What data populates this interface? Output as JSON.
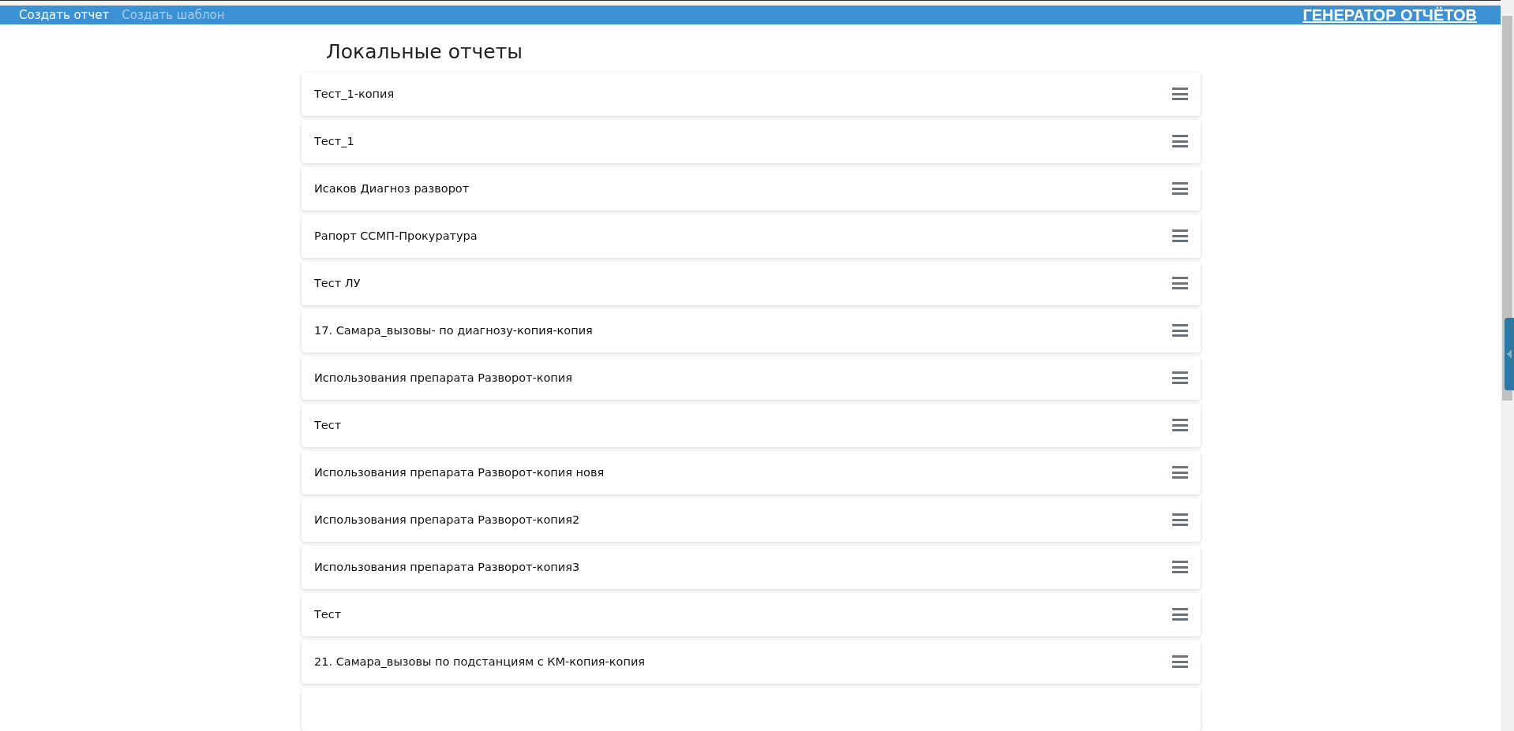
{
  "nav": [
    {
      "label": "Создать отчет",
      "selected": true
    },
    {
      "label": "Создать шаблон",
      "selected": false
    }
  ],
  "brand": "ГЕНЕРАТОР ОТЧЁТОВ",
  "page_title": "Локальные отчеты",
  "reports": [
    {
      "name": "Тест_1-копия"
    },
    {
      "name": "Тест_1"
    },
    {
      "name": "Исаков Диагноз разворот"
    },
    {
      "name": "Рапорт ССМП-Прокуратура"
    },
    {
      "name": "Тест ЛУ"
    },
    {
      "name": "17. Самара_вызовы- по диагнозу-копия-копия"
    },
    {
      "name": "Использования препарата Разворот-копия"
    },
    {
      "name": "Тест"
    },
    {
      "name": "Использования препарата Разворот-копия новя"
    },
    {
      "name": "Использования препарата Разворот-копия2"
    },
    {
      "name": "Использования препарата Разворот-копия3"
    },
    {
      "name": "Тест"
    },
    {
      "name": "21. Самара_вызовы по подстанциям с КМ-копия-копия"
    }
  ]
}
